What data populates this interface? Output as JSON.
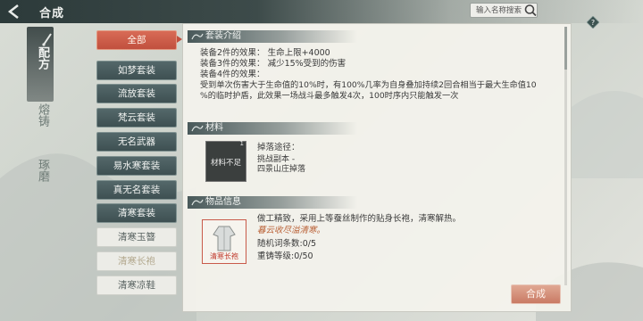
{
  "topbar": {
    "title": "合成",
    "search_placeholder": "输入名称搜索"
  },
  "tabs": [
    {
      "label": "配方",
      "active": true
    },
    {
      "label": "熔铸",
      "active": false
    },
    {
      "label": "琢磨",
      "active": false
    }
  ],
  "set_list": {
    "items": [
      {
        "label": "全部",
        "type": "main",
        "selected": true
      },
      {
        "label": "如梦套装",
        "type": "main"
      },
      {
        "label": "流放套装",
        "type": "main"
      },
      {
        "label": "梵云套装",
        "type": "main"
      },
      {
        "label": "无名武器",
        "type": "main"
      },
      {
        "label": "易水寒套装",
        "type": "main"
      },
      {
        "label": "真无名套装",
        "type": "main"
      },
      {
        "label": "清寒套装",
        "type": "main"
      },
      {
        "label": "清寒玉簪",
        "type": "sub"
      },
      {
        "label": "清寒长袍",
        "type": "sub",
        "dim": true
      },
      {
        "label": "清寒凉鞋",
        "type": "sub"
      }
    ]
  },
  "set_intro": {
    "title": "套装介绍",
    "lines": [
      "装备2件的效果：  生命上限+4000",
      "装备3件的效果：  减少15%受到的伤害",
      "装备4件的效果：",
      "受到单次伤害大于生命值的10%时，有100%几率为自身叠加持续2回合相当于最大生命值10",
      "%的临时护盾，此效果一场战斗最多触发4次，100时序内只能触发一次"
    ]
  },
  "material": {
    "title": "材料",
    "box_label": "材料不足",
    "box_count": "1",
    "drop_title": "掉落途径：",
    "drop_line1": "挑战副本 -",
    "drop_line2": "四景山庄掉落"
  },
  "item_info": {
    "title": "物品信息",
    "desc": "做工精致，采用上等蚕丝制作的贴身长袍，清寒解热。",
    "flavor": "暮云收尽溢清寒。",
    "affix_count": "随机词条数:0/5",
    "reforge_level": "重铸等级:0/50",
    "card_label": "清寒长袍"
  },
  "actions": {
    "craft_label": "合成"
  },
  "colors": {
    "selected_btn": "#c9503e",
    "main_btn": "#45585a",
    "accent_text": "#b95f34"
  },
  "icons": [
    "back-arrow-icon",
    "search-icon",
    "help-icon",
    "brush-icon",
    "swirl-icon",
    "robe-icon"
  ]
}
